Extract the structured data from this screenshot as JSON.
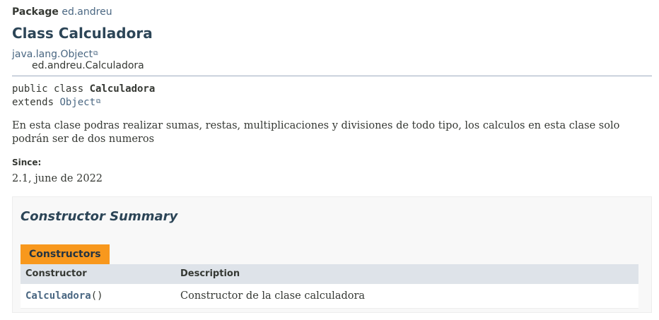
{
  "package": {
    "label": "Package",
    "name": "ed.andreu"
  },
  "class_title": "Class Calculadora",
  "inheritance": {
    "parent": "java.lang.Object",
    "child": "ed.andreu.Calculadora"
  },
  "signature": {
    "prefix": "public class ",
    "name": "Calculadora",
    "extends_kw": "extends ",
    "extends_class": "Object"
  },
  "description": "En esta clase podras realizar sumas, restas, multiplicaciones y divisiones de todo tipo, los calculos en esta clase solo podrán ser de dos numeros",
  "since": {
    "label": "Since:",
    "value": "2.1, june de 2022"
  },
  "constructor_summary": {
    "heading": "Constructor Summary",
    "tab_label": "Constructors",
    "columns": [
      "Constructor",
      "Description"
    ],
    "rows": [
      {
        "name": "Calculadora",
        "params": "()",
        "description": "Constructor de la clase calculadora"
      }
    ]
  },
  "colors": {
    "link": "#4a6782",
    "title": "#2c4557",
    "tab": "#f8981d",
    "table_header": "#dee3e9"
  },
  "icons": {
    "external_link": "external-link-icon"
  }
}
